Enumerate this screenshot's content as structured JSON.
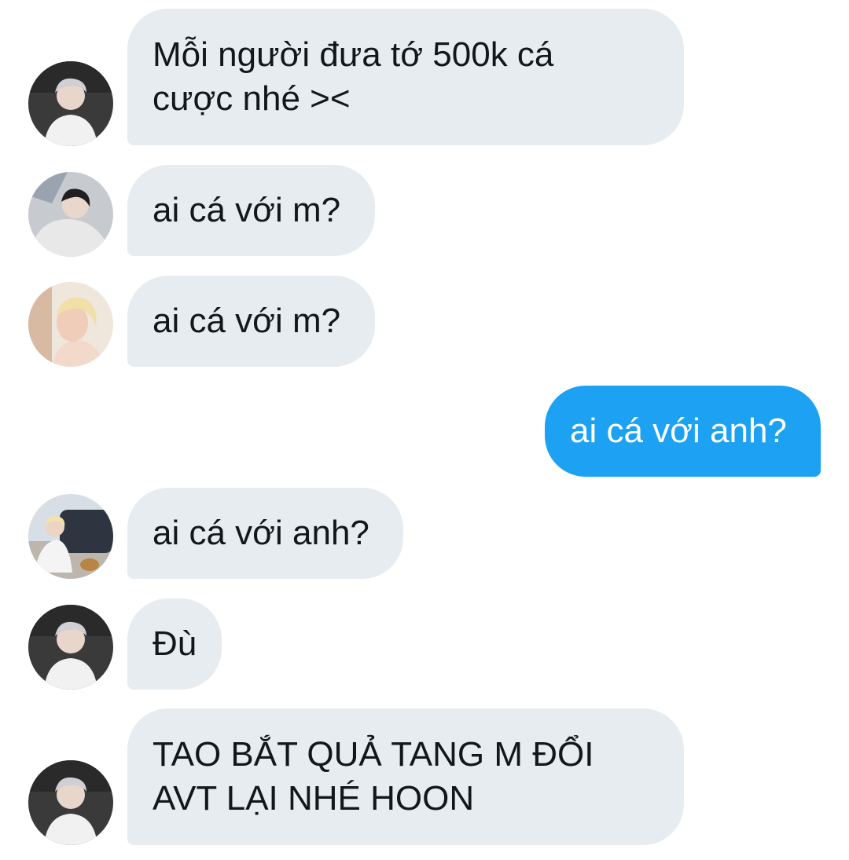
{
  "conversation": {
    "messages": [
      {
        "sender": "received",
        "avatar": "avatar-silver-hair-white-shirt",
        "text": " Mỗi người đưa tớ 500k cá\ncược nhé ><"
      },
      {
        "sender": "received",
        "avatar": "avatar-dark-hair-selfie",
        "text": "ai cá với m?"
      },
      {
        "sender": "received",
        "avatar": "avatar-blonde-profile",
        "text": "ai cá với m?"
      },
      {
        "sender": "sent",
        "text": "ai cá với anh?"
      },
      {
        "sender": "received",
        "avatar": "avatar-blonde-with-car-and-dog",
        "text": "ai cá với anh?"
      },
      {
        "sender": "received",
        "avatar": "avatar-silver-hair-white-shirt",
        "text": "Đù"
      },
      {
        "sender": "received",
        "avatar": "avatar-silver-hair-white-shirt",
        "text": "TAO BẮT QUẢ TANG M ĐỔI\nAVT LẠI NHÉ HOON"
      }
    ]
  },
  "colors": {
    "received_bubble": "#e6ecf0",
    "received_text": "#14171a",
    "sent_bubble": "#1da1f2",
    "sent_text": "#ffffff"
  }
}
